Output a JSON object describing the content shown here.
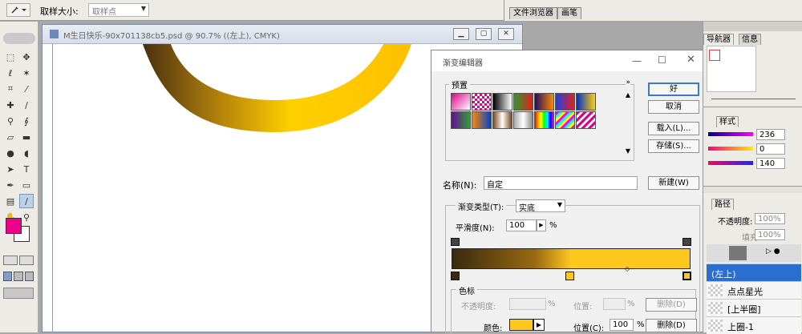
{
  "options_bar": {
    "sample_size_label": "取样大小:",
    "sample_size_value": "取样点",
    "tabs": [
      "文件浏览器",
      "画笔"
    ]
  },
  "document": {
    "title": "M生日快乐-90x701138cb5.psd @ 90.7% ((左上), CMYK)"
  },
  "gradient_editor": {
    "title": "渐变编辑器",
    "presets_label": "预置",
    "buttons": {
      "ok": "好",
      "cancel": "取消",
      "load": "载入(L)...",
      "save": "存储(S)...",
      "new": "新建(W)"
    },
    "name_label": "名称(N):",
    "name_value": "自定",
    "gradient_type_label": "渐变类型(T):",
    "gradient_type_value": "实底",
    "smoothness_label": "平滑度(N):",
    "smoothness_value": "100",
    "percent": "%",
    "stops_section_label": "色标",
    "opacity_label": "不透明度:",
    "location_label_top": "位置:",
    "delete_label": "删除(D)",
    "color_label": "颜色:",
    "location_label": "位置(C):",
    "location_value": "100",
    "colors": {
      "gradient_start": "#3a2a10",
      "gradient_end": "#ffc81e",
      "current_color": "#ffc81e"
    }
  },
  "panels": {
    "navigator_tabs": [
      "导航器",
      "信息"
    ],
    "color_tabs": [
      "样式"
    ],
    "color_values": [
      "236",
      "0",
      "140"
    ],
    "layers_tabs": [
      "路径"
    ],
    "opacity_label": "不透明度:",
    "opacity_value": "100%",
    "fill_label": "填充:",
    "fill_value": "100%",
    "layers": [
      "(左上)",
      "点点星光",
      "[上半圈]",
      "上圈-1"
    ]
  },
  "toolbox": {
    "foreground_color": "#ec008c",
    "background_color": "#ffffff"
  }
}
